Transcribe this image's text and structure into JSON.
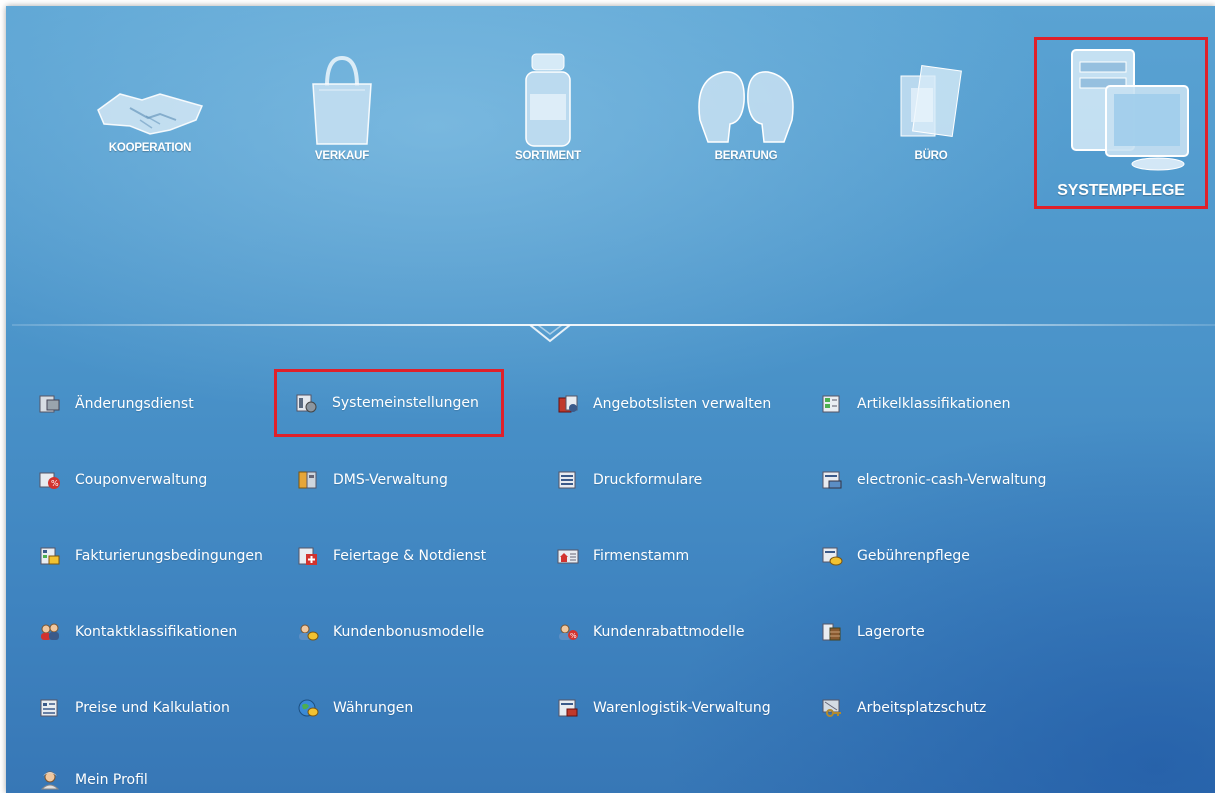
{
  "top_nav": [
    {
      "label": "KOOPERATION",
      "icon": "handshake-icon"
    },
    {
      "label": "VERKAUF",
      "icon": "shopping-bag-icon"
    },
    {
      "label": "SORTIMENT",
      "icon": "medicine-jar-icon"
    },
    {
      "label": "BERATUNG",
      "icon": "consultation-heads-icon"
    },
    {
      "label": "BÜRO",
      "icon": "office-documents-icon"
    },
    {
      "label": "SYSTEMPFLEGE",
      "icon": "computer-system-icon",
      "selected": true
    }
  ],
  "items": [
    {
      "label": "Änderungsdienst"
    },
    {
      "label": "Systemeinstellungen",
      "highlighted": true
    },
    {
      "label": "Angebotslisten verwalten"
    },
    {
      "label": "Artikelklassifikationen"
    },
    {
      "label": "Couponverwaltung"
    },
    {
      "label": "DMS-Verwaltung"
    },
    {
      "label": "Druckformulare"
    },
    {
      "label": "electronic-cash-Verwaltung"
    },
    {
      "label": "Fakturierungsbedingungen"
    },
    {
      "label": "Feiertage & Notdienst"
    },
    {
      "label": "Firmenstamm"
    },
    {
      "label": "Gebührenpflege"
    },
    {
      "label": "Kontaktklassifikationen"
    },
    {
      "label": "Kundenbonusmodelle"
    },
    {
      "label": "Kundenrabattmodelle"
    },
    {
      "label": "Lagerorte"
    },
    {
      "label": "Preise und Kalkulation"
    },
    {
      "label": "Währungen"
    },
    {
      "label": "Warenlogistik-Verwaltung"
    },
    {
      "label": "Arbeitsplatzschutz"
    },
    {
      "label": "Mein Profil"
    }
  ],
  "colors": {
    "highlight": "#e0202a",
    "background": "#4a93c9"
  }
}
